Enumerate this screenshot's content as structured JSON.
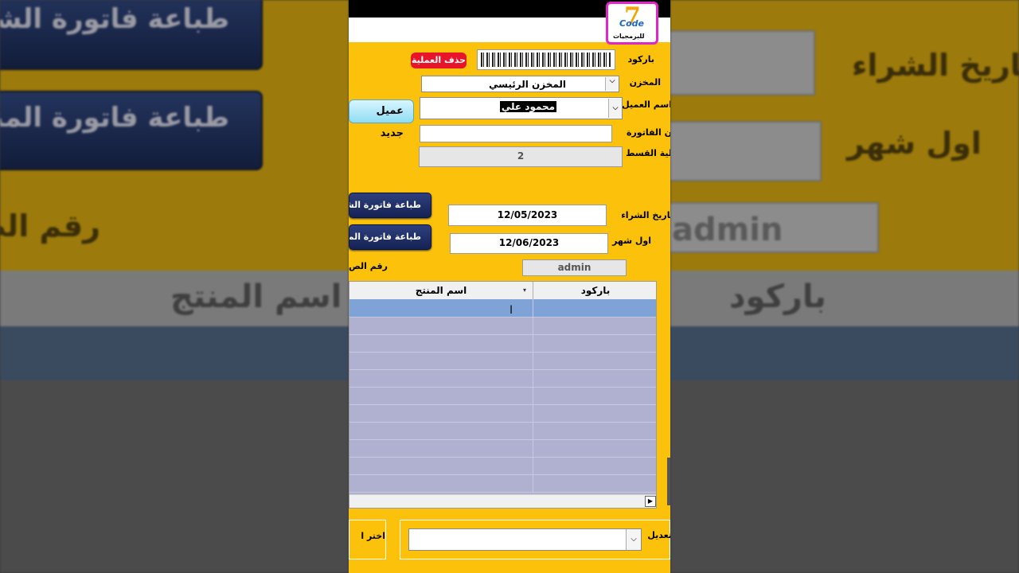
{
  "brand": {
    "number": "7",
    "code": "Code",
    "tagline": "للبرمجيات"
  },
  "labels": {
    "barcode": "باركود",
    "warehouse": "المخزن",
    "customer_name": "اسم العميل",
    "invoice": "ن الفاتورة",
    "installment": "لية القسط",
    "purchase_date": "تاريخ الشراء",
    "first_month": "اول شهر",
    "receipt_no": "رقم الص",
    "edit": "تعديل"
  },
  "buttons": {
    "delete_operation": "حذف العملية",
    "new_customer": "عميل جديد",
    "print_monthly": "طباعة فاتورة الشهر",
    "print_product": "طباعة فاتورة المنتج",
    "choose": "اختر ا"
  },
  "fields": {
    "warehouse_value": "المخزن الرئيسي",
    "customer_value": "محمود علي",
    "invoice_value": "",
    "installment_value": "2",
    "purchase_date_value": "12/05/2023",
    "first_month_value": "12/06/2023",
    "user_value": "admin",
    "edit_value": ""
  },
  "grid": {
    "columns": [
      "باركود",
      "اسم المنتج"
    ],
    "row_count": 11
  },
  "background": {
    "btn_monthly": "طباعة فاتورة الشه",
    "btn_product": "طباعة فاتورة المنت",
    "label_purchase": "تاريخ الشراء",
    "label_first": "اول شهر",
    "label_receipt": "رقم الص",
    "user": "admin",
    "col_product": "اسم المنتج",
    "col_barcode": "باركود"
  },
  "colors": {
    "form_bg": "#fcc20b",
    "accent_red": "#e8142a",
    "grid_active": "#7fa3d6",
    "grid_bg": "#b0b0d0"
  }
}
